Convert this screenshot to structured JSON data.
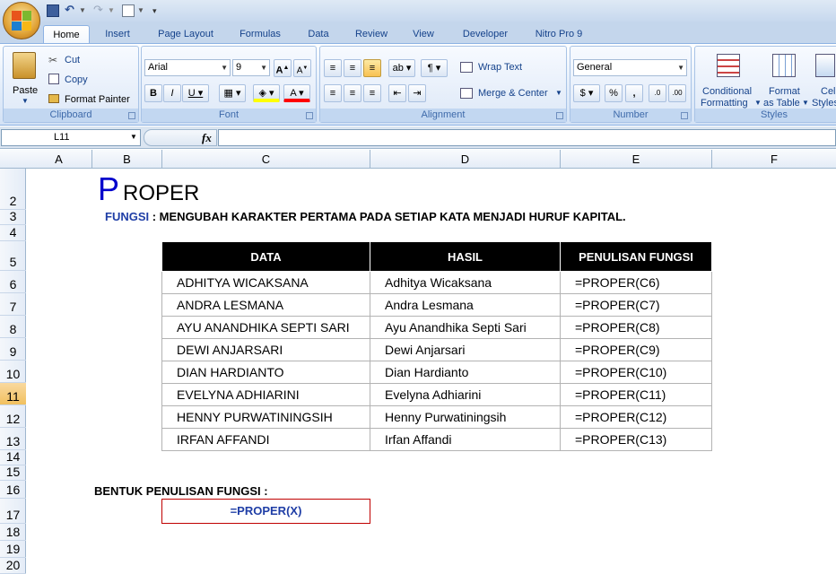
{
  "ribbon": {
    "tabs": [
      "Home",
      "Insert",
      "Page Layout",
      "Formulas",
      "Data",
      "Review",
      "View",
      "Developer",
      "Nitro Pro 9"
    ],
    "clipboard": {
      "paste": "Paste",
      "cut": "Cut",
      "copy": "Copy",
      "format_painter": "Format Painter",
      "label": "Clipboard"
    },
    "font": {
      "name": "Arial",
      "size": "9",
      "label": "Font"
    },
    "alignment": {
      "wrap_text": "Wrap Text",
      "merge_center": "Merge & Center",
      "label": "Alignment"
    },
    "number": {
      "format": "General",
      "label": "Number"
    },
    "styles": {
      "conditional": "Conditional",
      "formatting": "Formatting",
      "format_as": "Format",
      "as_table": "as Table",
      "cell": "Cell",
      "styles": "Styles",
      "label": "Styles"
    }
  },
  "formula_bar": {
    "name_box": "L11",
    "fx": "fx",
    "value": ""
  },
  "columns": [
    "A",
    "B",
    "C",
    "D",
    "E",
    "F"
  ],
  "rows": [
    "2",
    "3",
    "4",
    "5",
    "6",
    "7",
    "8",
    "9",
    "10",
    "11",
    "12",
    "13",
    "14",
    "15",
    "16",
    "17",
    "18",
    "19",
    "20"
  ],
  "selected_row": "11",
  "sheet": {
    "title_first": "P",
    "title_rest": "ROPER",
    "fungsi_label": "FUNGSI",
    "fungsi_text": " : MENGUBAH KARAKTER PERTAMA PADA SETIAP KATA MENJADI HURUF KAPITAL.",
    "table": {
      "headers": [
        "DATA",
        "HASIL",
        "PENULISAN FUNGSI"
      ],
      "rows": [
        [
          "ADHITYA WICAKSANA",
          "Adhitya Wicaksana",
          "=PROPER(C6)"
        ],
        [
          "ANDRA LESMANA",
          "Andra Lesmana",
          "=PROPER(C7)"
        ],
        [
          "AYU ANANDHIKA SEPTI SARI",
          "Ayu Anandhika Septi Sari",
          "=PROPER(C8)"
        ],
        [
          "DEWI ANJARSARI",
          "Dewi Anjarsari",
          "=PROPER(C9)"
        ],
        [
          "DIAN HARDIANTO",
          "Dian Hardianto",
          "=PROPER(C10)"
        ],
        [
          "EVELYNA ADHIARINI",
          "Evelyna Adhiarini",
          "=PROPER(C11)"
        ],
        [
          "HENNY PURWATININGSIH",
          "Henny Purwatiningsih",
          "=PROPER(C12)"
        ],
        [
          "IRFAN AFFANDI",
          "Irfan Affandi",
          "=PROPER(C13)"
        ]
      ]
    },
    "bentuk_label": "BENTUK PENULISAN FUNGSI :",
    "formula_syntax": "=PROPER(X)"
  }
}
